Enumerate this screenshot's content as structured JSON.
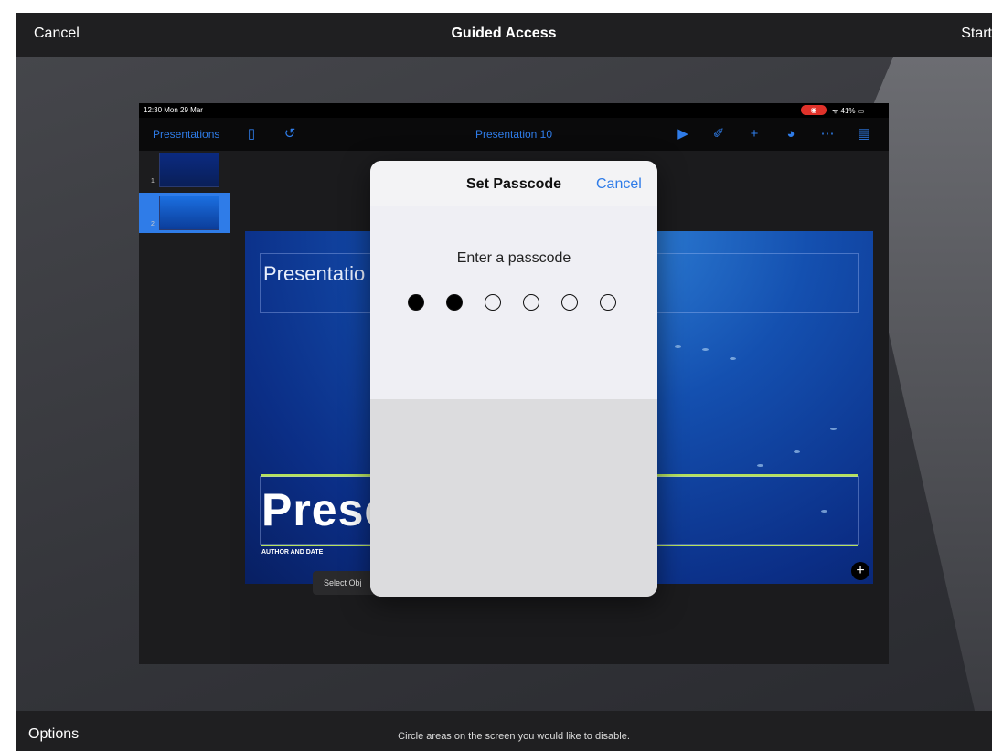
{
  "topbar": {
    "cancel": "Cancel",
    "title": "Guided Access",
    "start": "Start"
  },
  "bottombar": {
    "options": "Options",
    "hint": "Circle areas on the screen you would like to disable."
  },
  "ipad": {
    "status": {
      "time": "12:30  Mon 29 Mar",
      "battery": "41%",
      "recording": "◉"
    },
    "toolbar": {
      "presentations": "Presentations",
      "doc_title": "Presentation 10",
      "icons": [
        "sidebar-icon",
        "undo-icon",
        "play-icon",
        "brush-icon",
        "plus-icon",
        "collaborate-icon",
        "more-icon",
        "document-icon"
      ]
    },
    "navigator": {
      "slides": [
        {
          "num": "1"
        },
        {
          "num": "2"
        }
      ]
    },
    "slide": {
      "title_text": "Presentatio",
      "big_text": "Prese",
      "author": "AUTHOR AND DATE",
      "select_hint": "Select Obj"
    }
  },
  "dialog": {
    "title": "Set Passcode",
    "cancel": "Cancel",
    "prompt": "Enter a passcode",
    "entered": 2,
    "total": 6
  }
}
